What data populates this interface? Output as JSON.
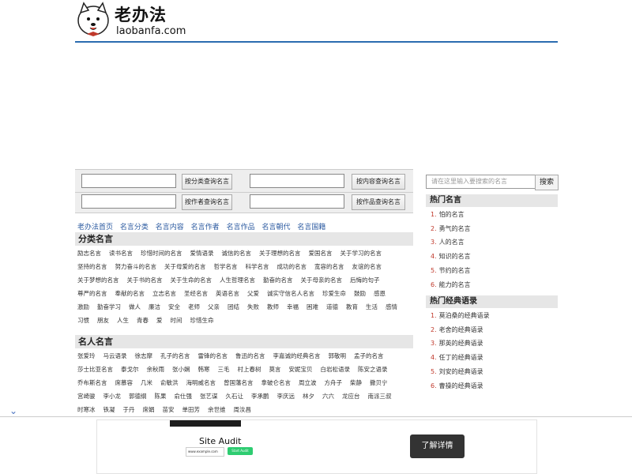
{
  "header": {
    "logo_cn": "老办法",
    "logo_en": "laobanfa.com",
    "logo_icon": "dog-mascot-icon"
  },
  "search_panel": {
    "btn_category": "按分类查询名言",
    "btn_content": "按内容查询名言",
    "btn_author": "按作者查询名言",
    "btn_work": "按作品查询名言"
  },
  "nav": [
    "老办法首页",
    "名言分类",
    "名言内容",
    "名言作者",
    "名言作品",
    "名言朝代",
    "名言国籍"
  ],
  "categories": {
    "title": "分类名言",
    "items": [
      "励志名言",
      "读书名言",
      "珍惜时间的名言",
      "爱情语录",
      "诚信的名言",
      "关于理想的名言",
      "爱国名言",
      "关于学习的名言",
      "坚持的名言",
      "努力奋斗的名言",
      "关于母爱的名言",
      "哲学名言",
      "科学名言",
      "成功的名言",
      "宽容的名言",
      "友谊的名言",
      "关于梦想的名言",
      "关于书的名言",
      "关于生命的名言",
      "人生哲理名言",
      "勤奋的名言",
      "关于母亲的名言",
      "后悔的句子",
      "尊严的名言",
      "奉献的名言",
      "立志名言",
      "圣经名言",
      "英语名言",
      "父爱",
      "诚实守信名人名言",
      "珍爱生命",
      "鼓励",
      "感恩",
      "激励",
      "勤奋学习",
      "做人",
      "廉洁",
      "安全",
      "老师",
      "父亲",
      "团结",
      "失败",
      "教师",
      "幸福",
      "困难",
      "道德",
      "教育",
      "生活",
      "感情",
      "习惯",
      "朋友",
      "人生",
      "青春",
      "爱",
      "时间",
      "珍惜生命"
    ]
  },
  "people": {
    "title": "名人名言",
    "items": [
      "张爱玲",
      "马云语录",
      "徐志摩",
      "孔子的名言",
      "雷锋的名言",
      "鲁迅的名言",
      "李嘉诚的经典名言",
      "郭敬明",
      "孟子的名言",
      "莎士比亚名言",
      "泰戈尔",
      "余秋雨",
      "张小娴",
      "韩寒",
      "三毛",
      "村上春树",
      "莫言",
      "安妮宝贝",
      "白岩松语录",
      "陈安之语录",
      "乔布斯名言",
      "席慕容",
      "几米",
      "俞敏洪",
      "海明威名言",
      "曾国藩名言",
      "拿破仑名言",
      "周立波",
      "方舟子",
      "柴静",
      "撒贝宁",
      "宫崎骏",
      "李小龙",
      "郭德纲",
      "陈果",
      "俞仕强",
      "张艺谋",
      "久石让",
      "李承鹏",
      "李庆远",
      "林夕",
      "六六",
      "龙应台",
      "南派三叔",
      "时寒冰",
      "铁凝",
      "于丹",
      "席娟",
      "苗安",
      "单田芳",
      "余世维",
      "周汝昌"
    ]
  },
  "right": {
    "search_placeholder": "请在这里输入要搜索的名言",
    "search_btn": "搜索",
    "hot_title": "热门名言",
    "hot_items": [
      "怕的名言",
      "勇气的名言",
      "人的名言",
      "知识的名言",
      "节约的名言",
      "能力的名言"
    ],
    "classic_title": "热门经典语录",
    "classic_items": [
      "莫泊桑的经典语录",
      "老舍的经典语录",
      "那英的经典语录",
      "任丁的经典语录",
      "刘安的经典语录",
      "曹操的经典语录"
    ]
  },
  "ad": {
    "title": "Site Audit",
    "input_text": "www.example.com",
    "go_label": "Start Audit",
    "cta": "了解详情",
    "chevron_icon": "chevron-down-icon"
  },
  "colors": {
    "accent": "#2b6cb0",
    "link": "#2b5aa0",
    "number": "#c0392b"
  }
}
